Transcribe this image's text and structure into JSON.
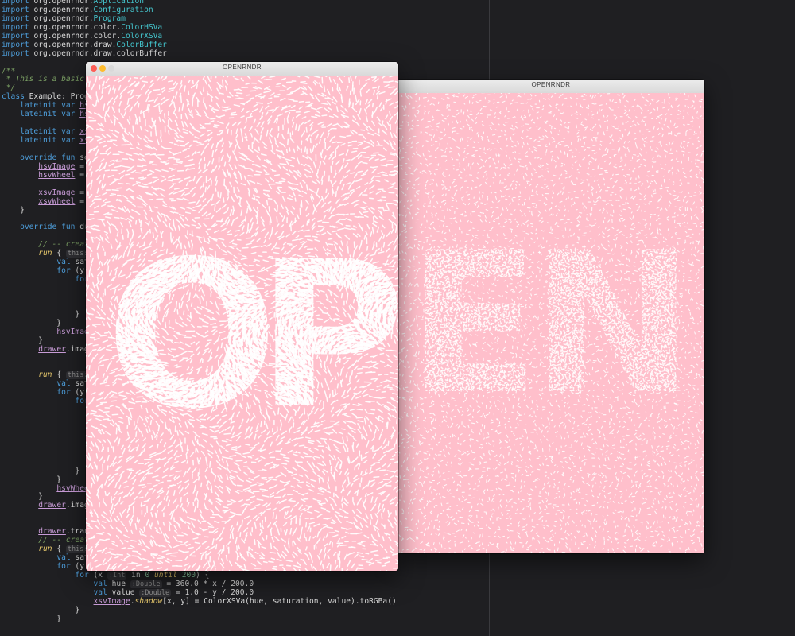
{
  "editor": {
    "lines": [
      [
        [
          "kw",
          "import "
        ],
        [
          "p",
          "org.openrndr."
        ],
        [
          "cls",
          "Application"
        ]
      ],
      [
        [
          "kw",
          "import "
        ],
        [
          "p",
          "org.openrndr."
        ],
        [
          "cls",
          "Configuration"
        ]
      ],
      [
        [
          "kw",
          "import "
        ],
        [
          "p",
          "org.openrndr."
        ],
        [
          "cls",
          "Program"
        ]
      ],
      [
        [
          "kw",
          "import "
        ],
        [
          "p",
          "org.openrndr.color."
        ],
        [
          "cls",
          "ColorHSVa"
        ]
      ],
      [
        [
          "kw",
          "import "
        ],
        [
          "p",
          "org.openrndr.color."
        ],
        [
          "cls",
          "ColorXSVa"
        ]
      ],
      [
        [
          "kw",
          "import "
        ],
        [
          "p",
          "org.openrndr.draw."
        ],
        [
          "cls",
          "ColorBuffer"
        ]
      ],
      [
        [
          "kw",
          "import "
        ],
        [
          "p",
          "org.openrndr.draw.colorBuffer"
        ]
      ],
      [],
      [
        [
          "com",
          "/**"
        ]
      ],
      [
        [
          "com",
          " * This is a basic ex"
        ]
      ],
      [
        [
          "com",
          " */"
        ]
      ],
      [
        [
          "kw",
          "class "
        ],
        [
          "p",
          "Example: Progra"
        ]
      ],
      [
        [
          "p",
          "    "
        ],
        [
          "kw",
          "lateinit var "
        ],
        [
          "ul",
          "hsvI"
        ]
      ],
      [
        [
          "p",
          "    "
        ],
        [
          "kw",
          "lateinit var "
        ],
        [
          "ul",
          "hsvW"
        ]
      ],
      [],
      [
        [
          "p",
          "    "
        ],
        [
          "kw",
          "lateinit var "
        ],
        [
          "ul",
          "xsvI"
        ]
      ],
      [
        [
          "p",
          "    "
        ],
        [
          "kw",
          "lateinit var "
        ],
        [
          "ul",
          "xsvW"
        ]
      ],
      [],
      [
        [
          "p",
          "    "
        ],
        [
          "kw",
          "override fun "
        ],
        [
          "p",
          "setu"
        ]
      ],
      [
        [
          "p",
          "        "
        ],
        [
          "ul",
          "hsvImage"
        ],
        [
          "p",
          " = "
        ],
        [
          "it",
          "co"
        ]
      ],
      [
        [
          "p",
          "        "
        ],
        [
          "ul",
          "hsvWheel"
        ],
        [
          "p",
          " = "
        ],
        [
          "it",
          "co"
        ]
      ],
      [],
      [
        [
          "p",
          "        "
        ],
        [
          "ul",
          "xsvImage"
        ],
        [
          "p",
          " = "
        ],
        [
          "it",
          "co"
        ]
      ],
      [
        [
          "p",
          "        "
        ],
        [
          "ul",
          "xsvWheel"
        ],
        [
          "p",
          " = "
        ],
        [
          "it",
          "co"
        ]
      ],
      [
        [
          "p",
          "    }"
        ]
      ],
      [],
      [
        [
          "p",
          "    "
        ],
        [
          "kw",
          "override fun "
        ],
        [
          "p",
          "draw"
        ]
      ],
      [],
      [
        [
          "p",
          "        "
        ],
        [
          "com",
          "// -- create"
        ]
      ],
      [
        [
          "p",
          "        "
        ],
        [
          "it",
          "run"
        ],
        [
          "p",
          " { "
        ],
        [
          "hint",
          "this: Exa"
        ]
      ],
      [
        [
          "p",
          "            "
        ],
        [
          "kw",
          "val "
        ],
        [
          "p",
          "satur"
        ]
      ],
      [
        [
          "p",
          "            "
        ],
        [
          "kw",
          "for "
        ],
        [
          "p",
          "(y "
        ],
        [
          "hint",
          ":In"
        ]
      ],
      [
        [
          "p",
          "                "
        ],
        [
          "kw",
          "for "
        ],
        [
          "p",
          "("
        ]
      ],
      [
        [
          "p",
          "                    v"
        ]
      ],
      [
        [
          "p",
          "                    v"
        ]
      ],
      [
        [
          "p",
          "                    h"
        ]
      ],
      [
        [
          "p",
          "                }"
        ]
      ],
      [
        [
          "p",
          "            }"
        ]
      ],
      [
        [
          "p",
          "            "
        ],
        [
          "ul",
          "hsvImage"
        ],
        [
          "p",
          "."
        ]
      ],
      [
        [
          "p",
          "        }"
        ]
      ],
      [
        [
          "p",
          "        "
        ],
        [
          "ul",
          "drawer"
        ],
        [
          "p",
          ".image("
        ]
      ],
      [],
      [],
      [
        [
          "p",
          "        "
        ],
        [
          "it",
          "run"
        ],
        [
          "p",
          " { "
        ],
        [
          "hint",
          "this: Exa"
        ]
      ],
      [
        [
          "p",
          "            "
        ],
        [
          "kw",
          "val "
        ],
        [
          "p",
          "satur"
        ]
      ],
      [
        [
          "p",
          "            "
        ],
        [
          "kw",
          "for "
        ],
        [
          "p",
          "(y "
        ],
        [
          "hint",
          ":In"
        ]
      ],
      [
        [
          "p",
          "                "
        ],
        [
          "kw",
          "for "
        ],
        [
          "p",
          "("
        ]
      ],
      [],
      [
        [
          "p",
          "                    v"
        ]
      ],
      [
        [
          "p",
          "                    v"
        ]
      ],
      [
        [
          "p",
          "                    v"
        ]
      ],
      [],
      [
        [
          "p",
          "                    v"
        ]
      ],
      [
        [
          "p",
          "                    h"
        ]
      ],
      [
        [
          "p",
          "                }"
        ]
      ],
      [
        [
          "p",
          "            }"
        ]
      ],
      [
        [
          "p",
          "            "
        ],
        [
          "ul",
          "hsvWheel"
        ],
        [
          "p",
          "."
        ]
      ],
      [
        [
          "p",
          "        }"
        ]
      ],
      [
        [
          "p",
          "        "
        ],
        [
          "ul",
          "drawer"
        ],
        [
          "p",
          ".image("
        ]
      ],
      [],
      [],
      [
        [
          "p",
          "        "
        ],
        [
          "ul",
          "drawer"
        ],
        [
          "p",
          ".transl"
        ]
      ],
      [
        [
          "p",
          "        "
        ],
        [
          "com",
          "// -- create"
        ]
      ],
      [
        [
          "p",
          "        "
        ],
        [
          "it",
          "run"
        ],
        [
          "p",
          " { "
        ],
        [
          "hint",
          "this: Exa"
        ]
      ],
      [
        [
          "p",
          "            "
        ],
        [
          "kw",
          "val "
        ],
        [
          "p",
          "satur"
        ]
      ],
      [
        [
          "p",
          "            "
        ],
        [
          "kw",
          "for "
        ],
        [
          "p",
          "(y "
        ],
        [
          "hint",
          ":Int"
        ],
        [
          "p",
          " in "
        ],
        [
          "num",
          "0"
        ],
        [
          "p",
          " "
        ],
        [
          "it",
          "until"
        ],
        [
          "p",
          " "
        ],
        [
          "num",
          "200"
        ],
        [
          "p",
          ") {"
        ]
      ],
      [
        [
          "p",
          "                "
        ],
        [
          "kw",
          "for "
        ],
        [
          "p",
          "(x "
        ],
        [
          "hint",
          ":Int"
        ],
        [
          "p",
          " in "
        ],
        [
          "num",
          "0"
        ],
        [
          "p",
          " "
        ],
        [
          "it",
          "until"
        ],
        [
          "p",
          " "
        ],
        [
          "num",
          "200"
        ],
        [
          "p",
          ") {"
        ]
      ],
      [
        [
          "p",
          "                    "
        ],
        [
          "kw",
          "val "
        ],
        [
          "p",
          "hue "
        ],
        [
          "hint",
          ":Double"
        ],
        [
          "p",
          " = 360.0 * x / 200.0"
        ]
      ],
      [
        [
          "p",
          "                    "
        ],
        [
          "kw",
          "val "
        ],
        [
          "p",
          "value "
        ],
        [
          "hint",
          ":Double"
        ],
        [
          "p",
          " = 1.0 - y / 200.0"
        ]
      ],
      [
        [
          "p",
          "                    "
        ],
        [
          "ul",
          "xsvImage"
        ],
        [
          "p",
          "."
        ],
        [
          "it",
          "shadow"
        ],
        [
          "p",
          "[x, y] = ColorXSVa(hue, saturation, value).toRGBa()"
        ]
      ],
      [
        [
          "p",
          "                }"
        ]
      ],
      [
        [
          "p",
          "            }"
        ]
      ]
    ]
  },
  "window_left": {
    "title": "OPENRNDR",
    "traffic_lights": [
      "#fd5f57",
      "#febc2e",
      "#d9d9d9"
    ],
    "background": "#ffbfcb",
    "letters": [
      "O",
      "P"
    ]
  },
  "window_right": {
    "title": "OPENRNDR",
    "background": "#ffbfcb",
    "letters": [
      "E",
      "N"
    ]
  }
}
